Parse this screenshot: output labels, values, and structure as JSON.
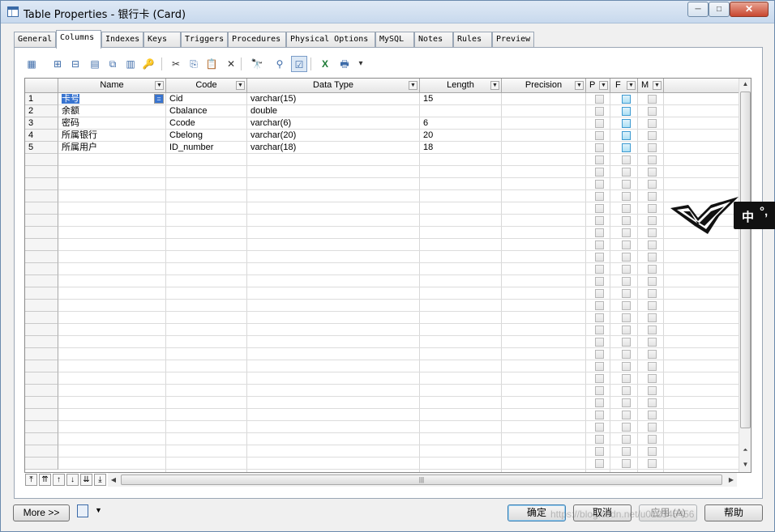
{
  "window": {
    "title": "Table Properties - 银行卡 (Card)",
    "min_label": "─",
    "max_label": "□",
    "close_label": "✕"
  },
  "tabs": [
    "General",
    "Columns",
    "Indexes",
    "Keys",
    "Triggers",
    "Procedures",
    "Physical Options",
    "MySQL",
    "Notes",
    "Rules",
    "Preview"
  ],
  "active_tab": "Columns",
  "toolbar_icons": [
    {
      "name": "properties-icon",
      "glyph": "▦"
    },
    {
      "name": "insert-row-icon",
      "glyph": "⊞"
    },
    {
      "name": "add-row-icon",
      "glyph": "⊟"
    },
    {
      "name": "add-columns-icon",
      "glyph": "▤"
    },
    {
      "name": "replicate-icon",
      "glyph": "⧉"
    },
    {
      "name": "paste-columns-icon",
      "glyph": "▥"
    },
    {
      "name": "key-icon",
      "glyph": "🔑"
    },
    {
      "name": "cut-icon",
      "glyph": "✂"
    },
    {
      "name": "copy-icon",
      "glyph": "⎘"
    },
    {
      "name": "paste-icon",
      "glyph": "📋"
    },
    {
      "name": "delete-icon",
      "glyph": "✕"
    },
    {
      "name": "find-icon",
      "glyph": "🔭"
    },
    {
      "name": "filter-icon",
      "glyph": "⚲"
    },
    {
      "name": "customize-columns-icon",
      "glyph": "☑"
    },
    {
      "name": "excel-export-icon",
      "glyph": "X"
    },
    {
      "name": "print-icon",
      "glyph": "🖶"
    },
    {
      "name": "dropdown-icon",
      "glyph": "▾"
    }
  ],
  "columns": {
    "name": "Name",
    "code": "Code",
    "data_type": "Data Type",
    "length": "Length",
    "precision": "Precision",
    "p": "P",
    "f": "F",
    "m": "M"
  },
  "rows": [
    {
      "num": "1",
      "name": "卡号",
      "code": "Cid",
      "data_type": "varchar(15)",
      "length": "15",
      "precision": "",
      "p": false,
      "f": true,
      "m": false
    },
    {
      "num": "2",
      "name": "余额",
      "code": "Cbalance",
      "data_type": "double",
      "length": "",
      "precision": "",
      "p": false,
      "f": true,
      "m": false
    },
    {
      "num": "3",
      "name": "密码",
      "code": "Ccode",
      "data_type": "varchar(6)",
      "length": "6",
      "precision": "",
      "p": false,
      "f": true,
      "m": false
    },
    {
      "num": "4",
      "name": "所属银行",
      "code": "Cbelong",
      "data_type": "varchar(20)",
      "length": "20",
      "precision": "",
      "p": false,
      "f": true,
      "m": false
    },
    {
      "num": "5",
      "name": "所属用户",
      "code": "ID_number",
      "data_type": "varchar(18)",
      "length": "18",
      "precision": "",
      "p": false,
      "f": true,
      "m": false
    }
  ],
  "empty_rows": 26,
  "cell_edit_button": "=",
  "nav_buttons": [
    "⤒",
    "⇈",
    "↑",
    "↓",
    "⇊",
    "⤓"
  ],
  "footer": {
    "more_label": "More >>",
    "ok_label": "确定",
    "cancel_label": "取消",
    "apply_label": "应用 (A)",
    "help_label": "帮助"
  },
  "ime": {
    "lang": "中",
    "punct": "°,"
  },
  "watermark": "https://blog.csdn.net/u012345456"
}
